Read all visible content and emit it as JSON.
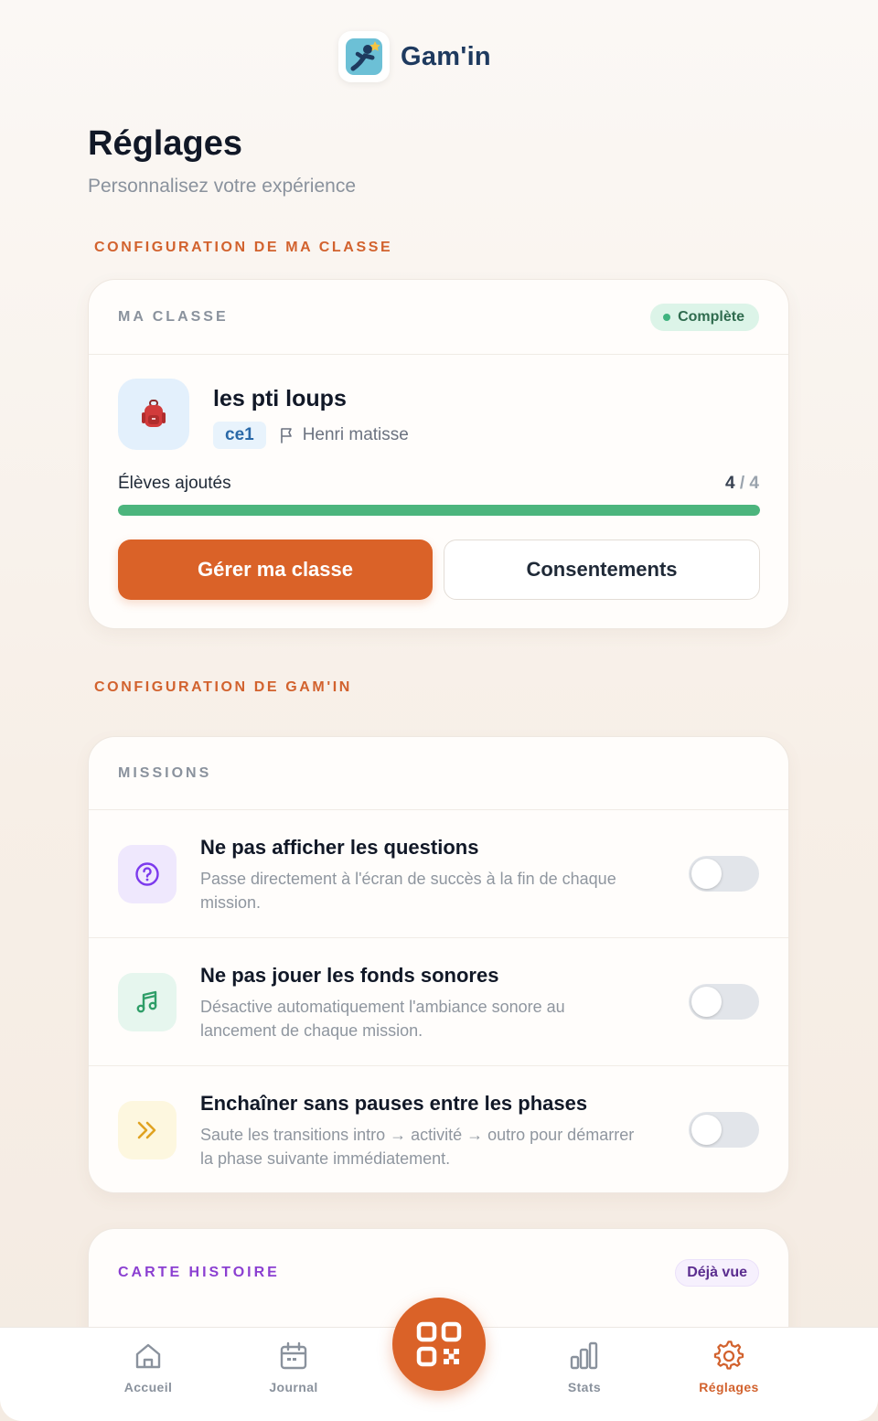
{
  "app": {
    "name": "Gam'in"
  },
  "page": {
    "title": "Réglages",
    "subtitle": "Personnalisez votre expérience"
  },
  "sections": {
    "class_config": "CONFIGURATION DE MA CLASSE",
    "gamin_config": "CONFIGURATION DE GAM'IN"
  },
  "class_card": {
    "title": "MA CLASSE",
    "status": "Complète",
    "class_name": "les pti loups",
    "level": "ce1",
    "school": "Henri matisse",
    "students_label": "Élèves ajoutés",
    "students_added": "4",
    "students_total": "/ 4",
    "progress": 1.0,
    "manage_button": "Gérer ma classe",
    "consents_button": "Consentements"
  },
  "missions_card": {
    "title": "MISSIONS",
    "settings": [
      {
        "title": "Ne pas afficher les questions",
        "description": "Passe directement à l'écran de succès à la fin de chaque mission.",
        "icon": "question-circle-icon",
        "enabled": false
      },
      {
        "title": "Ne pas jouer les fonds sonores",
        "description": "Désactive automatiquement l'ambiance sonore au lancement de chaque mission.",
        "icon": "music-note-icon",
        "enabled": false
      },
      {
        "title": "Enchaîner sans pauses entre les phases",
        "description": "Saute les transitions intro → activité → outro pour démarrer la phase suivante immédiatement.",
        "icon": "double-chevron-right-icon",
        "enabled": false
      }
    ]
  },
  "story_card": {
    "title": "CARTE HISTOIRE",
    "status": "Déjà vue"
  },
  "nav": {
    "items": [
      {
        "label": "Accueil",
        "icon": "home-icon"
      },
      {
        "label": "Journal",
        "icon": "calendar-icon"
      },
      {
        "label": "Stats",
        "icon": "bar-chart-icon"
      },
      {
        "label": "Réglages",
        "icon": "gear-icon"
      }
    ],
    "active": "Réglages",
    "center_action_icon": "qr-code-icon"
  },
  "colors": {
    "accent": "#da6228",
    "success": "#4cb57d",
    "story_accent": "#8b3fd1",
    "text_muted": "#8a929d"
  }
}
